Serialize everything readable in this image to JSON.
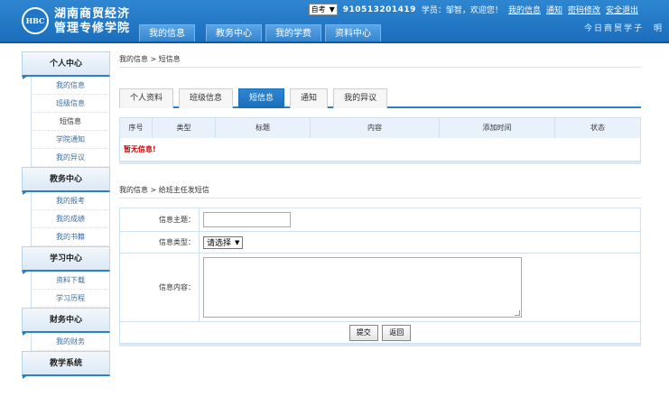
{
  "header": {
    "logo_text": "HBC",
    "school_line1": "湖南商贸经济",
    "school_line2": "管理专修学院",
    "nav": [
      "我的信息",
      "教务中心",
      "我的学费",
      "资料中心"
    ],
    "select_value": "自考",
    "user_id": "910513201419",
    "welcome": "学员：邹智，欢迎您！",
    "links": [
      "我的信息",
      "通知",
      "密码修改",
      "安全退出"
    ],
    "slogan": "今日商贸学子　明"
  },
  "sidebar": {
    "sections": [
      {
        "title": "个人中心",
        "items": [
          "我的信息",
          "班级信息",
          "短信息",
          "学院通知",
          "我的异议"
        ]
      },
      {
        "title": "教务中心",
        "items": [
          "我的报考",
          "我的成绩",
          "我的书籍"
        ]
      },
      {
        "title": "学习中心",
        "items": [
          "资料下载",
          "学习历程"
        ]
      },
      {
        "title": "财务中心",
        "items": [
          "我的财务"
        ]
      },
      {
        "title": "教学系统",
        "items": []
      }
    ]
  },
  "main": {
    "breadcrumb": "我的信息 > 短信息",
    "tabs": [
      "个人资料",
      "班级信息",
      "短信息",
      "通知",
      "我的异议"
    ],
    "table_headers": [
      "序号",
      "类型",
      "标题",
      "内容",
      "添加时间",
      "状态"
    ],
    "empty_text": "暂无信息!",
    "breadcrumb2": "我的信息 > 给班主任发短信",
    "form": {
      "subject_label": "信息主题：",
      "type_label": "信息类型：",
      "type_value": "请选择",
      "content_label": "信息内容：",
      "submit": "提交",
      "back": "返回"
    }
  }
}
